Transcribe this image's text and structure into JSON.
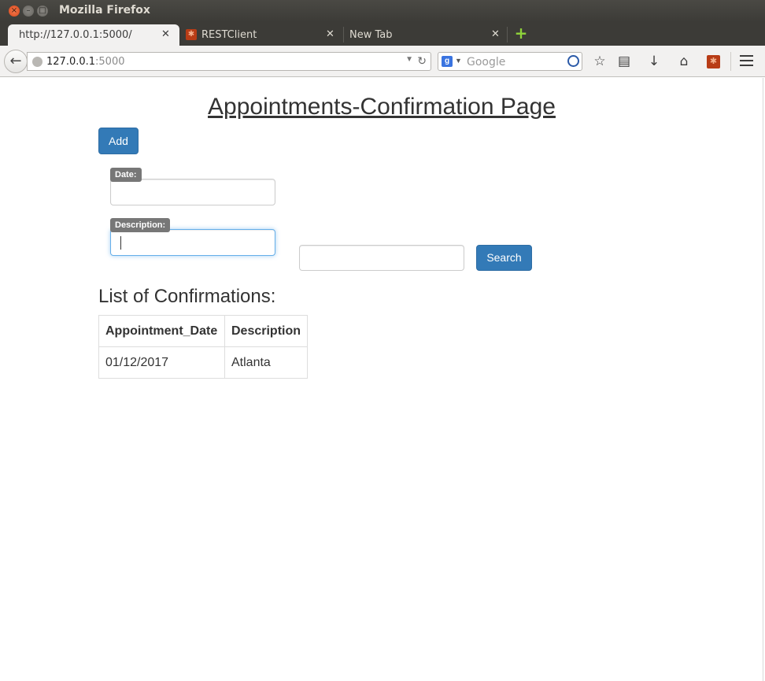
{
  "window": {
    "title": "Mozilla Firefox"
  },
  "tabs": [
    {
      "label": "http://127.0.0.1:5000/",
      "active": true
    },
    {
      "label": "RESTClient",
      "active": false
    },
    {
      "label": "New Tab",
      "active": false
    }
  ],
  "navbar": {
    "url_host": "127.0.0.1",
    "url_port": ":5000",
    "search_placeholder": "Google"
  },
  "page": {
    "title": "Appointments-Confirmation Page",
    "add_label": "Add",
    "date_label": "Date:",
    "description_label": "Description:",
    "date_value": "",
    "description_value": "",
    "search_value": "",
    "search_label": "Search",
    "list_heading": "List of Confirmations:",
    "table": {
      "headers": [
        "Appointment_Date",
        "Description"
      ],
      "rows": [
        [
          "01/12/2017",
          "Atlanta"
        ]
      ]
    }
  },
  "colors": {
    "primary_button": "#337ab7",
    "label_badge": "#777777",
    "focus_border": "#66afe9",
    "titlebar": "#3c3b37"
  }
}
